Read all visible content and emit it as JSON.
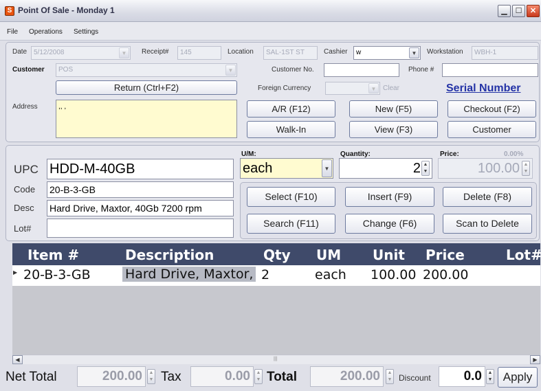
{
  "window": {
    "title": "Point Of Sale - Monday 1",
    "icon": "S"
  },
  "menu": [
    "File",
    "Operations",
    "Settings"
  ],
  "header": {
    "date_label": "Date",
    "date_value": "5/12/2008",
    "receipt_label": "Receipt#",
    "receipt_value": "145",
    "location_label": "Location",
    "location_value": "SAL-1ST ST",
    "cashier_label": "Cashier",
    "cashier_value": "w",
    "workstation_label": "Workstation",
    "workstation_value": "WBH-1",
    "customer_label": "Customer",
    "customer_value": "POS",
    "customer_no_label": "Customer No.",
    "customer_no_value": "",
    "phone_label": "Phone #",
    "phone_value": "",
    "foreign_currency_label": "Foreign Currency",
    "foreign_currency_value": "",
    "clear_label": "Clear",
    "address_label": "Address",
    "address_value": ",,  ,",
    "return_button": "Return (Ctrl+F2)",
    "serial_number_link": "Serial Number",
    "ar_button": "A/R (F12)",
    "new_button": "New (F5)",
    "checkout_button": "Checkout (F2)",
    "walkin_button": "Walk-In",
    "view_button": "View (F3)",
    "customer_button": "Customer"
  },
  "entry": {
    "upc_label": "UPC",
    "upc_value": "HDD-M-40GB",
    "code_label": "Code",
    "code_value": "20-B-3-GB",
    "desc_label": "Desc",
    "desc_value": "Hard Drive, Maxtor, 40Gb 7200 rpm",
    "lot_label": "Lot#",
    "lot_value": "",
    "um_label": "U/M:",
    "um_value": "each",
    "quantity_label": "Quantity:",
    "quantity_value": "2",
    "price_label": "Price:",
    "price_pct": "0.00%",
    "price_value": "100.00",
    "select_button": "Select (F10)",
    "insert_button": "Insert (F9)",
    "delete_button": "Delete (F8)",
    "search_button": "Search (F11)",
    "change_button": "Change (F6)",
    "scan_delete_button": "Scan to Delete"
  },
  "grid": {
    "columns": [
      "Item #",
      "Description",
      "Qty",
      "UM",
      "Unit",
      "Price",
      "Lot#"
    ],
    "rows": [
      {
        "item": "20-B-3-GB",
        "description": "Hard Drive, Maxtor,",
        "qty": "2",
        "um": "each",
        "unit": "100.00",
        "price": "200.00",
        "lot": ""
      }
    ]
  },
  "footer": {
    "net_total_label": "Net Total",
    "net_total_value": "200.00",
    "tax_label": "Tax",
    "tax_value": "0.00",
    "total_label": "Total",
    "total_value": "200.00",
    "discount_label": "Discount",
    "discount_value": "0.0",
    "apply_button": "Apply"
  },
  "colors": {
    "grid_header": "#3f4a6a",
    "address_bg": "#fffbd0",
    "link": "#2433a6",
    "accent": "#e9540f"
  }
}
